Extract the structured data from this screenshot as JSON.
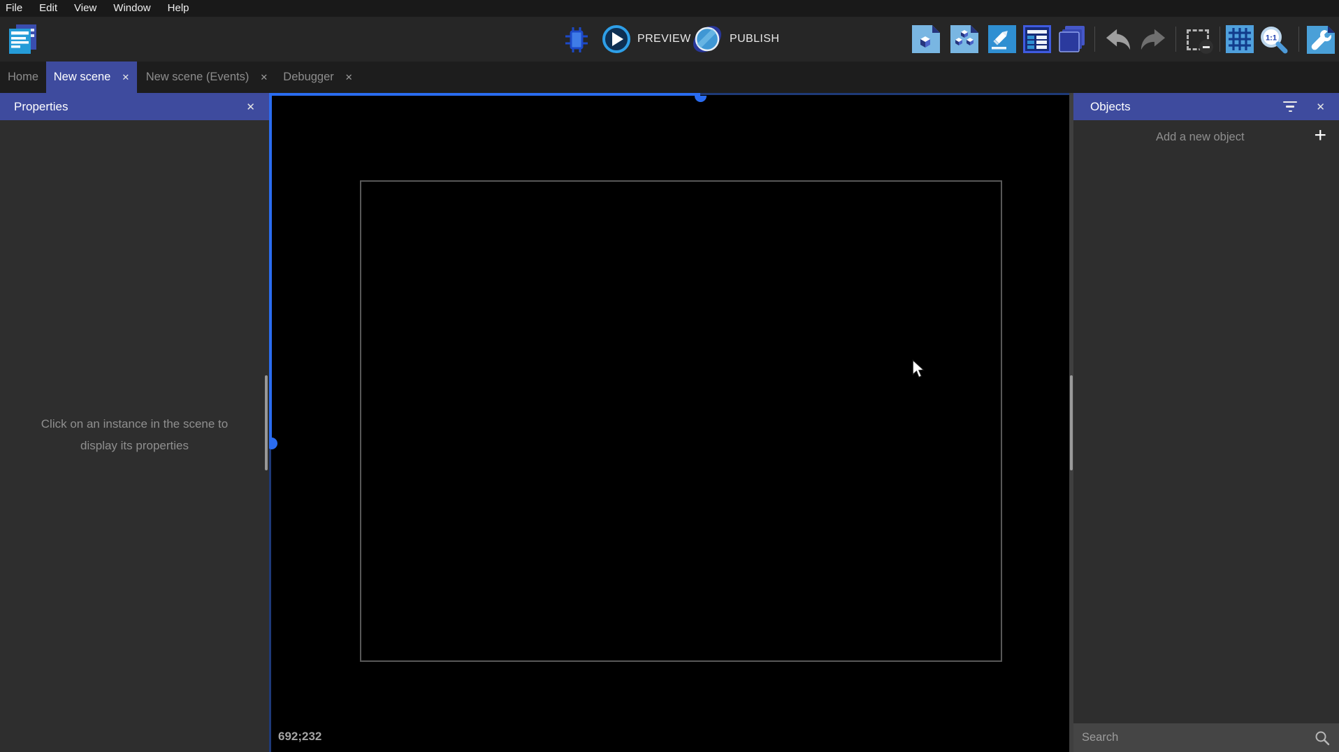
{
  "menu": {
    "items": [
      "File",
      "Edit",
      "View",
      "Window",
      "Help"
    ]
  },
  "toolbar": {
    "preview_label": "PREVIEW",
    "publish_label": "PUBLISH"
  },
  "tabs": {
    "home": "Home",
    "scene": "New scene",
    "events": "New scene (Events)",
    "debugger": "Debugger"
  },
  "icons": {
    "close": "✕",
    "plus": "+",
    "zoom_ratio_label": "1:1"
  },
  "properties_panel": {
    "title": "Properties",
    "empty_message_line1": "Click on an instance in the scene to",
    "empty_message_line2": "display its properties"
  },
  "scene_canvas": {
    "cursor_coordinates": "692;232"
  },
  "objects_panel": {
    "title": "Objects",
    "add_button_label": "Add a new object",
    "search_placeholder": "Search"
  },
  "colors": {
    "accent_header": "#3e4b9e",
    "selection_blue": "#2a6cf0",
    "selection_navy": "#1e3a78",
    "canvas_background": "#000000",
    "panel_background": "#2e2e2e",
    "toolbar_background": "#262626"
  }
}
